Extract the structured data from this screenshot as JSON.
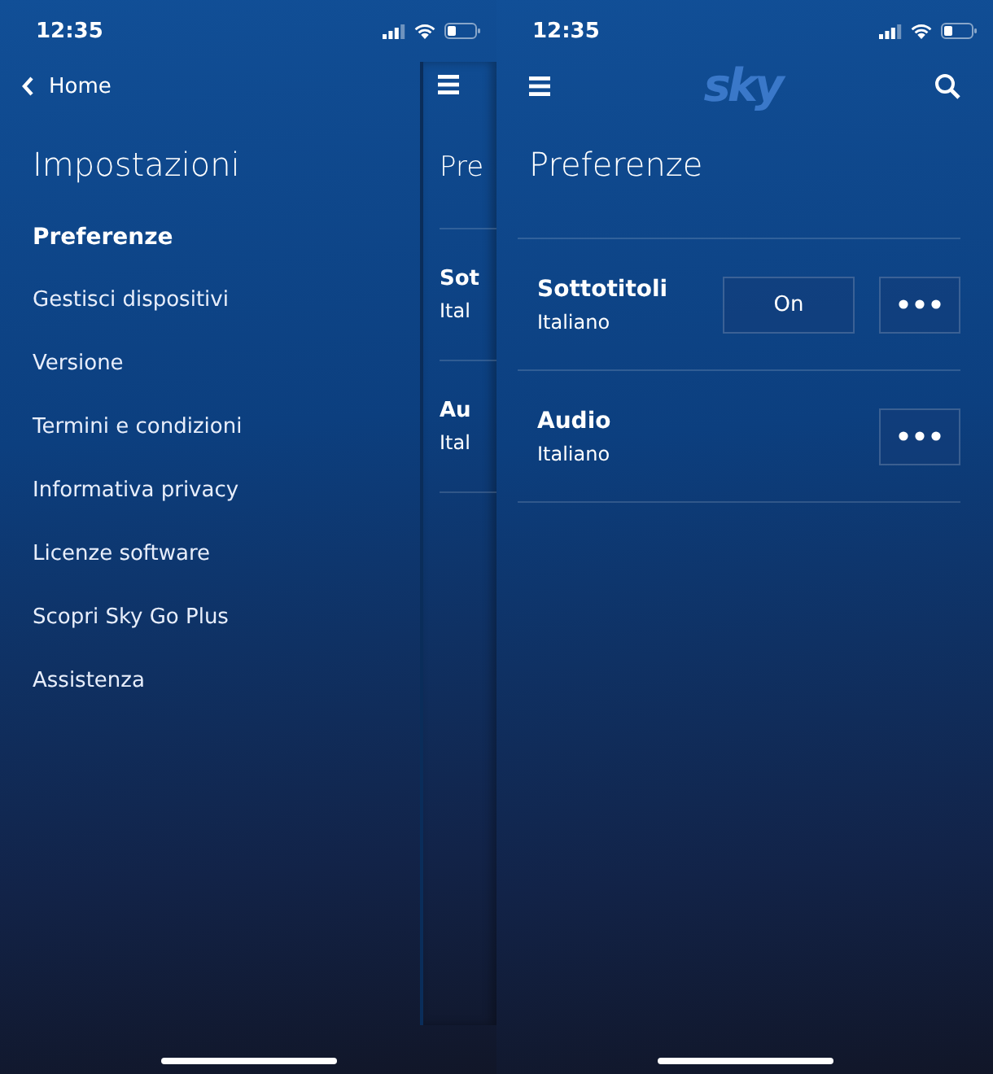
{
  "settings_screen": {
    "status_bar": {
      "time": "12:35"
    },
    "back": "Home",
    "title": "Impostazioni",
    "menu": [
      {
        "label": "Preferenze",
        "selected": true
      },
      {
        "label": "Gestisci dispositivi",
        "selected": false
      },
      {
        "label": "Versione",
        "selected": false
      },
      {
        "label": "Termini e condizioni",
        "selected": false
      },
      {
        "label": "Informativa privacy",
        "selected": false
      },
      {
        "label": "Licenze software",
        "selected": false
      },
      {
        "label": "Scopri Sky Go Plus",
        "selected": false
      },
      {
        "label": "Assistenza",
        "selected": false
      }
    ],
    "peek": {
      "title": "Pre",
      "rows": [
        {
          "name": "Sot",
          "value": "Ital"
        },
        {
          "name": "Au",
          "value": "Ital"
        }
      ]
    }
  },
  "preferences_screen": {
    "status_bar": {
      "time": "12:35"
    },
    "logo": "sky",
    "title": "Preferenze",
    "rows": [
      {
        "name": "Sottotitoli",
        "value": "Italiano",
        "toggle": "On"
      },
      {
        "name": "Audio",
        "value": "Italiano"
      }
    ]
  }
}
